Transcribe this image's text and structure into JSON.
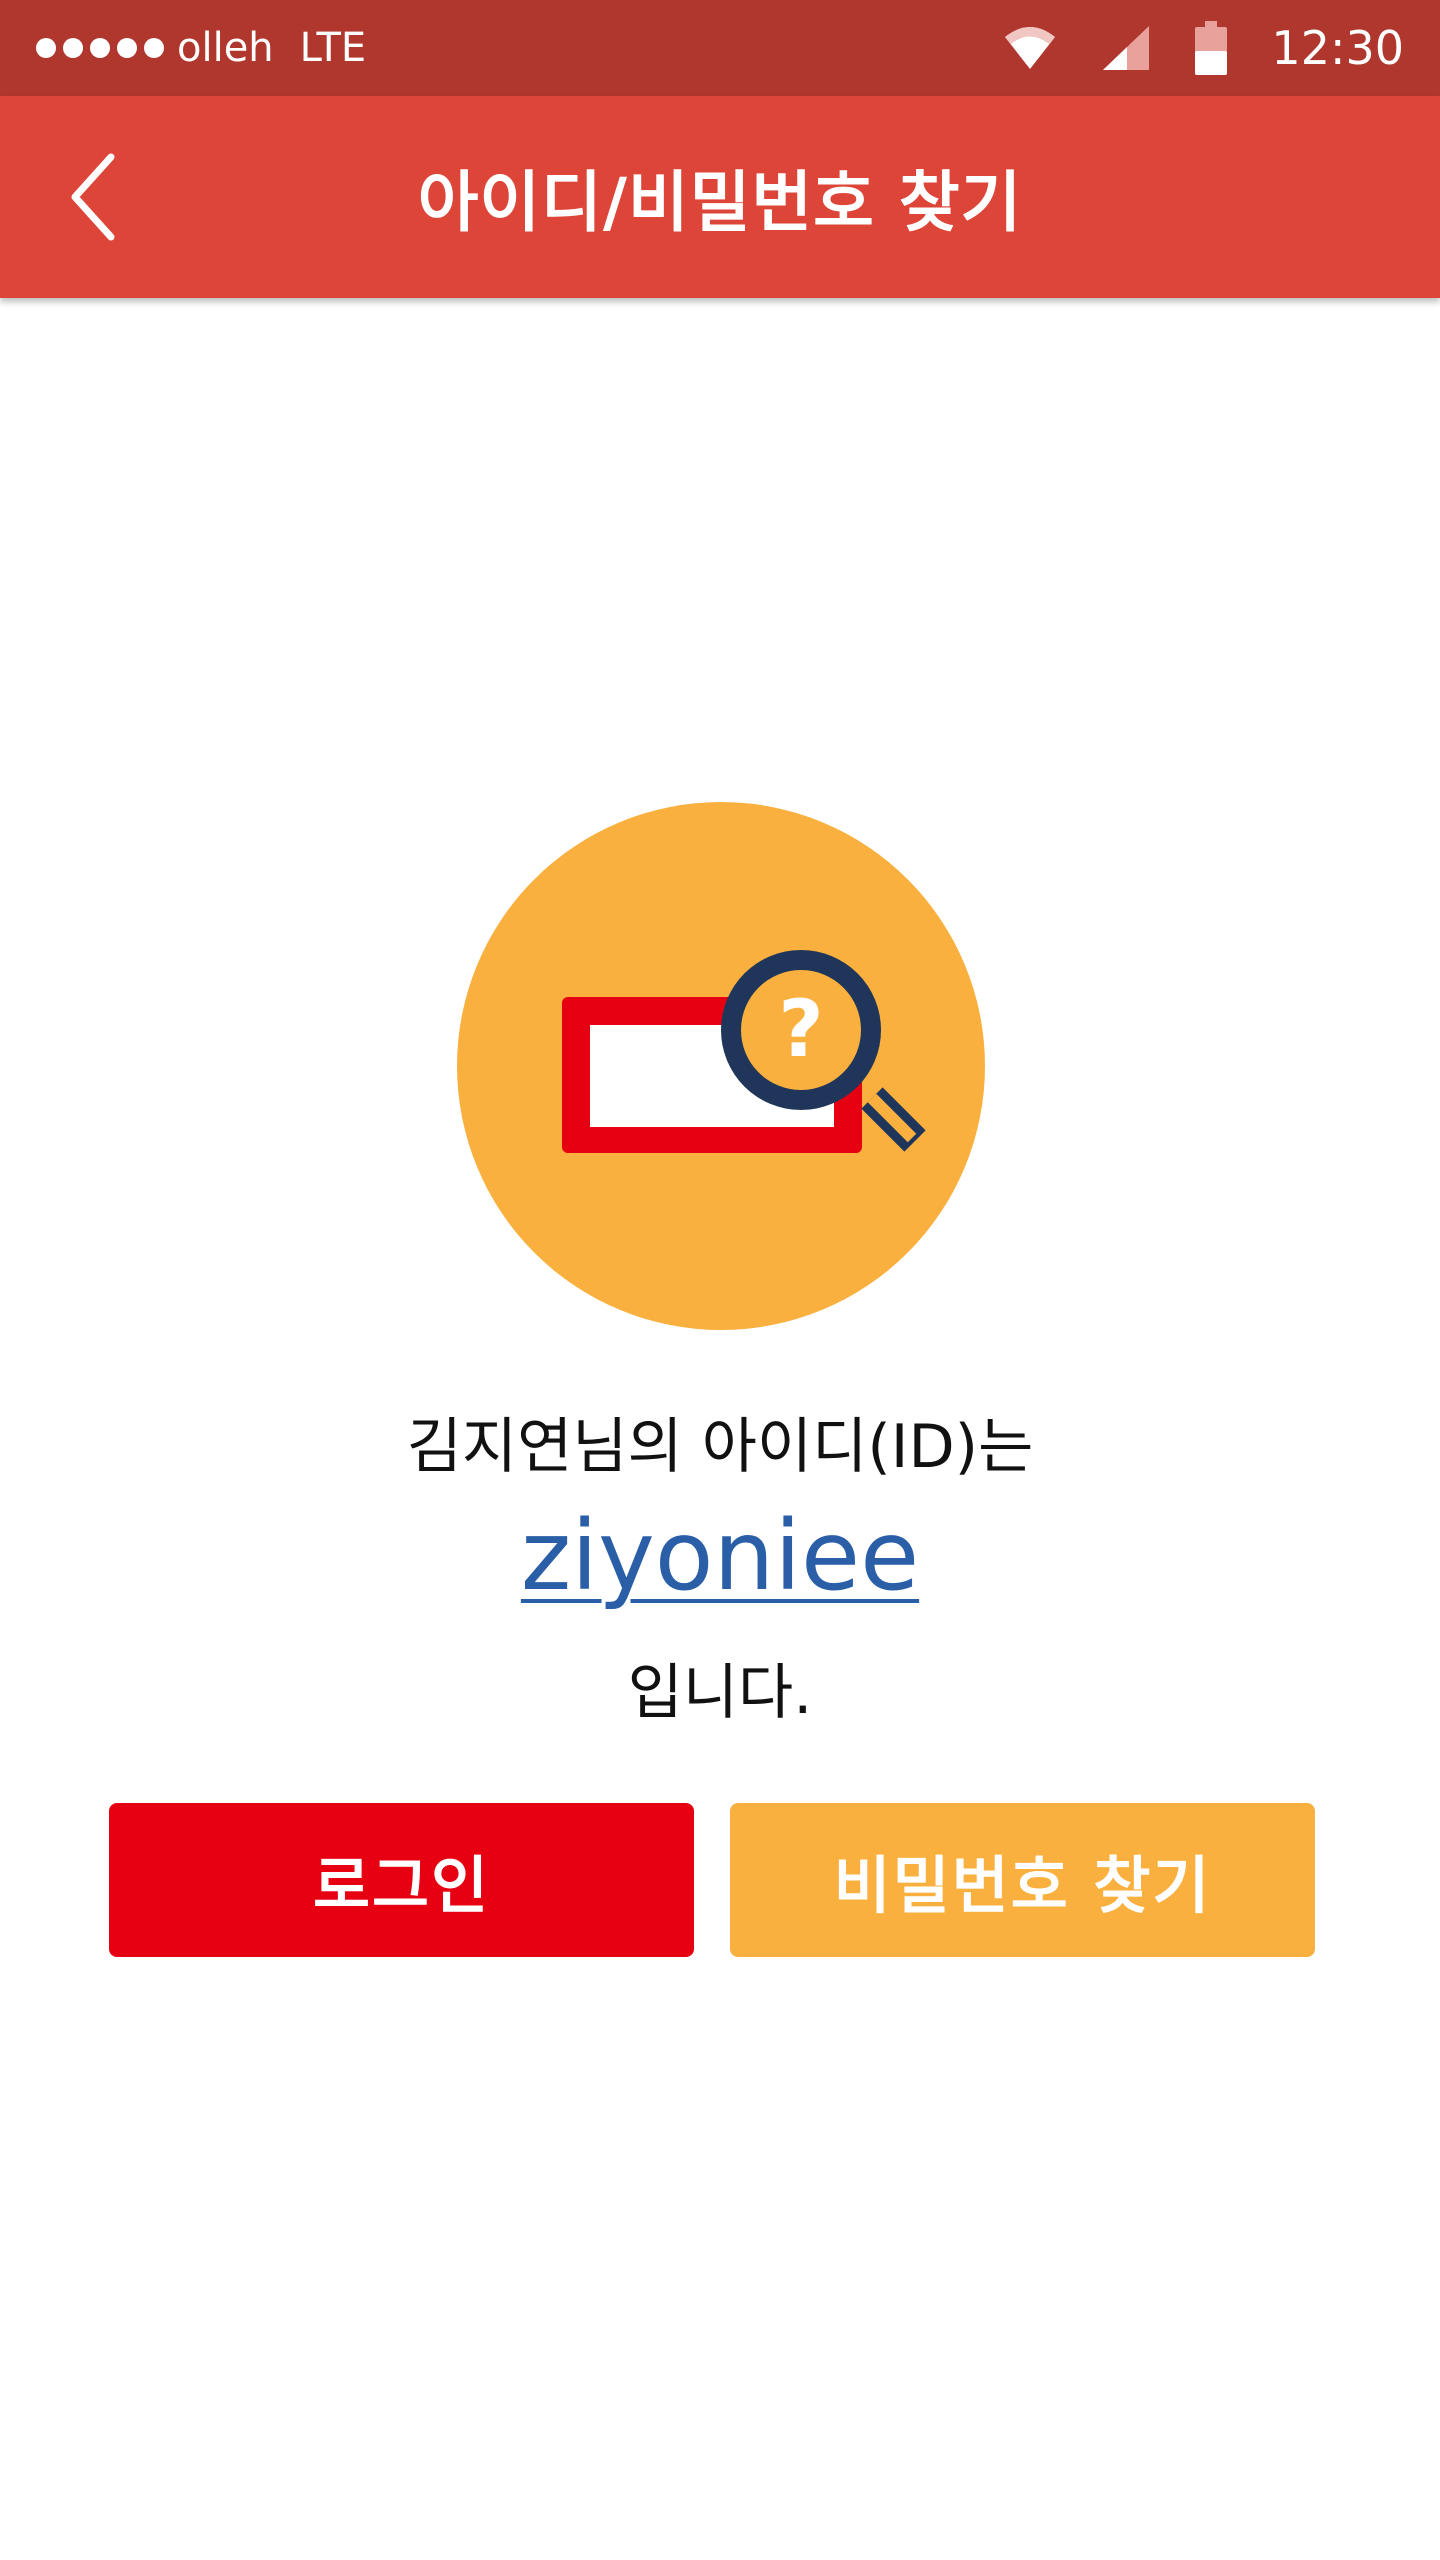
{
  "status_bar": {
    "carrier": "olleh",
    "network": "LTE",
    "time": "12:30",
    "icons": [
      "wifi-icon",
      "signal-icon",
      "battery-icon"
    ],
    "signal_dots": 5
  },
  "app_bar": {
    "title": "아이디/비밀번호 찾기",
    "back_icon": "chevron-left-icon"
  },
  "illustration": {
    "icon": "search-id-icon",
    "question_mark": "?"
  },
  "result": {
    "line1": "김지연님의 아이디(ID)는",
    "user_id": "ziyoniee",
    "line3": "입니다."
  },
  "buttons": {
    "login_label": "로그인",
    "find_password_label": "비밀번호 찾기"
  },
  "colors": {
    "status_bar": "#b0372d",
    "app_bar": "#de4539",
    "login_button": "#e60012",
    "find_password_button": "#f9b03e",
    "illustration_circle": "#f9b03e",
    "magnifier": "#1f3559",
    "id_text": "#2a5fa8"
  }
}
